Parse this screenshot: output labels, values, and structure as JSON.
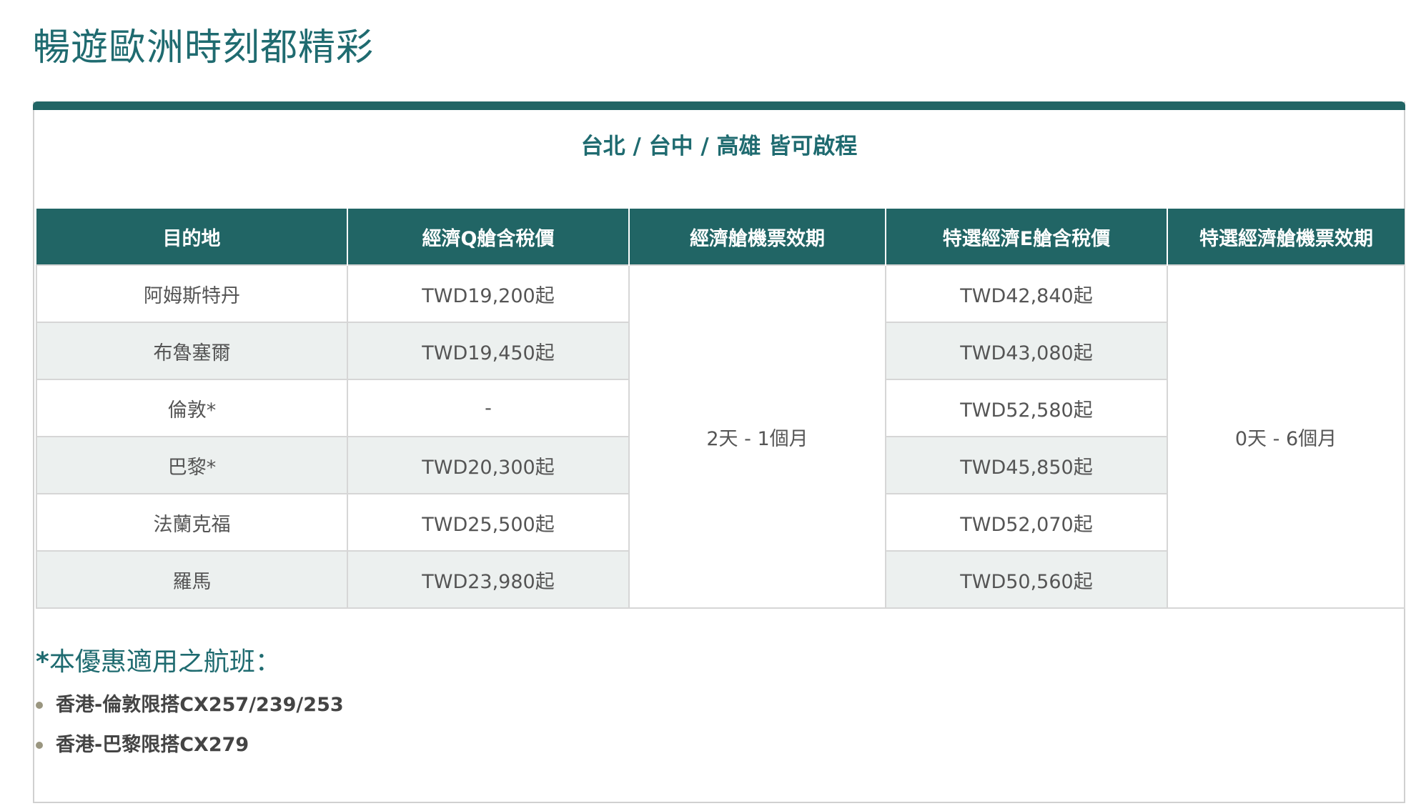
{
  "page": {
    "title": "暢遊歐洲時刻都精彩"
  },
  "card": {
    "subtitle": "台北 / 台中 / 高雄 皆可啟程",
    "accent_color": "#216565"
  },
  "table": {
    "headers": [
      "目的地",
      "經濟Q艙含稅價",
      "經濟艙機票效期",
      "特選經濟E艙含稅價",
      "特選經濟艙機票效期"
    ],
    "rows": [
      {
        "destination": "阿姆斯特丹",
        "economy_price": "TWD19,200起",
        "premium_price": "TWD42,840起"
      },
      {
        "destination": "布魯塞爾",
        "economy_price": "TWD19,450起",
        "premium_price": "TWD43,080起"
      },
      {
        "destination": "倫敦*",
        "economy_price": "-",
        "premium_price": "TWD52,580起"
      },
      {
        "destination": "巴黎*",
        "economy_price": "TWD20,300起",
        "premium_price": "TWD45,850起"
      },
      {
        "destination": "法蘭克福",
        "economy_price": "TWD25,500起",
        "premium_price": "TWD52,070起"
      },
      {
        "destination": "羅馬",
        "economy_price": "TWD23,980起",
        "premium_price": "TWD50,560起"
      }
    ],
    "economy_validity": "2天 - 1個月",
    "premium_validity": "0天 - 6個月",
    "stripe_color": "#ecf0ef"
  },
  "notes": {
    "asterisk": "*",
    "title": "本優惠適用之航班：",
    "items": [
      "香港-倫敦限搭CX257/239/253",
      "香港-巴黎限搭CX279"
    ]
  }
}
